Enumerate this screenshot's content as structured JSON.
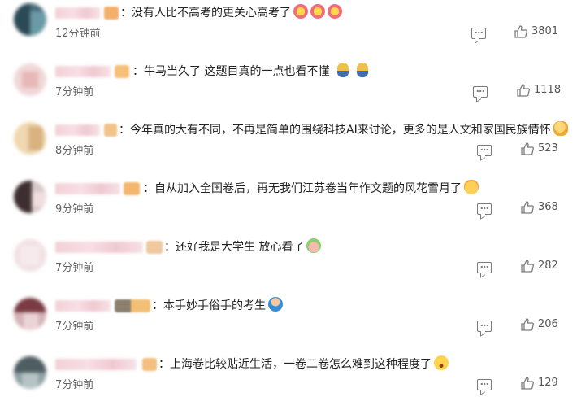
{
  "comments": [
    {
      "text": "：没有人比不高考的更关心高考了",
      "emojis": [
        "flower",
        "flower",
        "flower"
      ],
      "time": "12分钟前",
      "likes": "3801"
    },
    {
      "text": "：牛马当久了 这题目真的一点也看不懂",
      "emojis": [
        "tear",
        "tear"
      ],
      "time": "7分钟前",
      "likes": "1118"
    },
    {
      "text": "：今年真的大有不同，不再是简单的围绕科技AI来讨论，更多的是人文和家国民族情怀",
      "emojis": [
        "thumb"
      ],
      "time": "8分钟前",
      "likes": "523"
    },
    {
      "text": "：自从加入全国卷后，再无我们江苏卷当年作文题的风花雪月了",
      "emojis": [
        "cat"
      ],
      "time": "9分钟前",
      "likes": "368"
    },
    {
      "text": "：还好我是大学生 放心看了",
      "emojis": [
        "melon"
      ],
      "time": "7分钟前",
      "likes": "282"
    },
    {
      "text": "：本手妙手俗手的考生",
      "emojis": [
        "person"
      ],
      "time": "7分钟前",
      "likes": "206"
    },
    {
      "text": "：上海卷比较贴近生活，一卷二卷怎么难到这种程度了",
      "emojis": [
        "shock"
      ],
      "time": "7分钟前",
      "likes": "129"
    }
  ],
  "icons": {
    "reply": "comment-icon",
    "like": "thumbs-up-icon"
  },
  "colors": {
    "text": "#222222",
    "meta": "#666666",
    "icon": "#7a7a7a"
  }
}
